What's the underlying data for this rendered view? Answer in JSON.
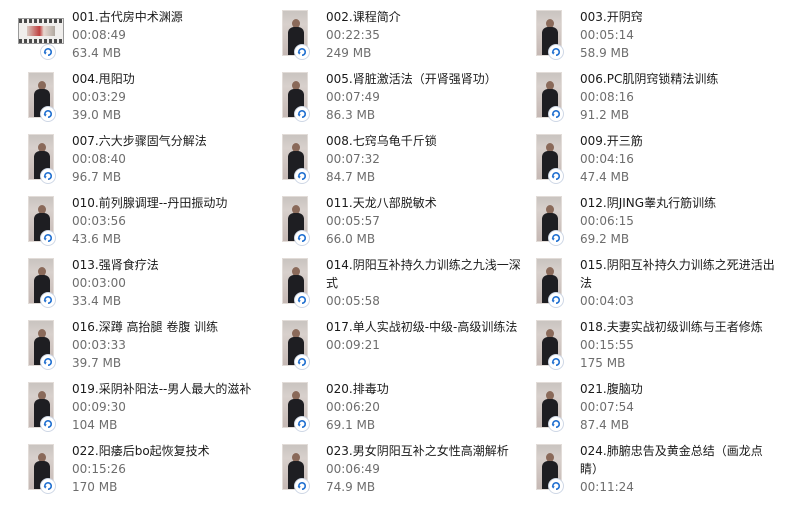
{
  "items": [
    {
      "title": "001.古代房中术渊源",
      "duration": "00:08:49",
      "size": "63.4 MB",
      "thumb": "film-strip-icon"
    },
    {
      "title": "002.课程简介",
      "duration": "00:22:35",
      "size": "249 MB",
      "thumb": "video-thumbnail"
    },
    {
      "title": "003.开阴窍",
      "duration": "00:05:14",
      "size": "58.9 MB",
      "thumb": "video-thumbnail"
    },
    {
      "title": "004.甩阳功",
      "duration": "00:03:29",
      "size": "39.0 MB",
      "thumb": "video-thumbnail"
    },
    {
      "title": "005.肾脏激活法（开肾强肾功）",
      "duration": "00:07:49",
      "size": "86.3 MB",
      "thumb": "video-thumbnail"
    },
    {
      "title": "006.PC肌阴窍锁精法训练",
      "duration": "00:08:16",
      "size": "91.2 MB",
      "thumb": "video-thumbnail"
    },
    {
      "title": "007.六大步骤固气分解法",
      "duration": "00:08:40",
      "size": "96.7 MB",
      "thumb": "video-thumbnail"
    },
    {
      "title": "008.七窍乌龟千斤锁",
      "duration": "00:07:32",
      "size": "84.7 MB",
      "thumb": "video-thumbnail"
    },
    {
      "title": "009.开三筋",
      "duration": "00:04:16",
      "size": "47.4 MB",
      "thumb": "video-thumbnail"
    },
    {
      "title": "010.前列腺调理--丹田振动功",
      "duration": "00:03:56",
      "size": "43.6 MB",
      "thumb": "video-thumbnail"
    },
    {
      "title": "011.天龙八部脱敏术",
      "duration": "00:05:57",
      "size": "66.0 MB",
      "thumb": "video-thumbnail"
    },
    {
      "title": "012.阴JING睾丸行筋训练",
      "duration": "00:06:15",
      "size": "69.2 MB",
      "thumb": "video-thumbnail"
    },
    {
      "title": "013.强肾食疗法",
      "duration": "00:03:00",
      "size": "33.4 MB",
      "thumb": "video-thumbnail"
    },
    {
      "title": "014.阴阳互补持久力训练之九浅一深式",
      "duration": "00:05:58",
      "size": "",
      "thumb": "video-thumbnail"
    },
    {
      "title": "015.阴阳互补持久力训练之死进活出法",
      "duration": "00:04:03",
      "size": "",
      "thumb": "video-thumbnail"
    },
    {
      "title": "016.深蹲 高抬腿 卷腹 训练",
      "duration": "00:03:33",
      "size": "39.7 MB",
      "thumb": "video-thumbnail"
    },
    {
      "title": "017.单人实战初级-中级-高级训练法",
      "duration": "00:09:21",
      "size": "",
      "thumb": "video-thumbnail"
    },
    {
      "title": "018.夫妻实战初级训练与王者修炼",
      "duration": "00:15:55",
      "size": "175 MB",
      "thumb": "video-thumbnail"
    },
    {
      "title": "019.采阴补阳法--男人最大的滋补",
      "duration": "00:09:30",
      "size": "104 MB",
      "thumb": "video-thumbnail"
    },
    {
      "title": "020.排毒功",
      "duration": "00:06:20",
      "size": "69.1 MB",
      "thumb": "video-thumbnail"
    },
    {
      "title": "021.腹脑功",
      "duration": "00:07:54",
      "size": "87.4 MB",
      "thumb": "video-thumbnail"
    },
    {
      "title": "022.阳痿后bo起恢复技术",
      "duration": "00:15:26",
      "size": "170 MB",
      "thumb": "video-thumbnail"
    },
    {
      "title": "023.男女阴阳互补之女性高潮解析",
      "duration": "00:06:49",
      "size": "74.9 MB",
      "thumb": "video-thumbnail"
    },
    {
      "title": "024.肺腑忠告及黄金总结（画龙点睛）",
      "duration": "00:11:24",
      "size": "",
      "thumb": "video-thumbnail"
    }
  ],
  "colors": {
    "title_text": "#1a1a1a",
    "meta_text": "#6d6d6d",
    "badge_arrow": "#1f6fd0",
    "background": "#ffffff"
  },
  "badge_icon": "sync-arrow-icon"
}
